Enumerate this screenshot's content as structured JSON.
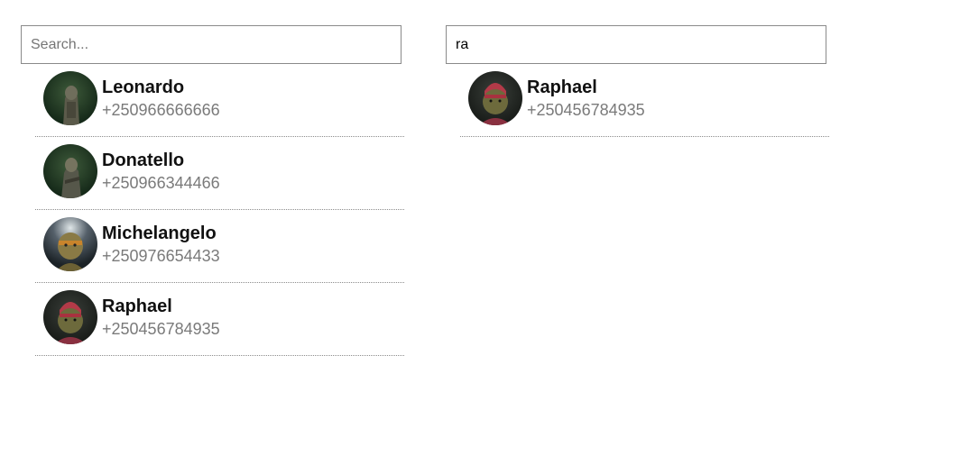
{
  "left_panel": {
    "search": {
      "placeholder": "Search...",
      "value": ""
    },
    "contacts": [
      {
        "name": "Leonardo",
        "phone": "+250966666666",
        "avatar": "turtle-avatar-icon"
      },
      {
        "name": "Donatello",
        "phone": "+250966344466",
        "avatar": "turtle-avatar-icon"
      },
      {
        "name": "Michelangelo",
        "phone": "+250976654433",
        "avatar": "turtle-avatar-icon"
      },
      {
        "name": "Raphael",
        "phone": "+250456784935",
        "avatar": "turtle-avatar-icon"
      }
    ]
  },
  "right_panel": {
    "search": {
      "placeholder": "Search...",
      "value": "ra"
    },
    "contacts": [
      {
        "name": "Raphael",
        "phone": "+250456784935",
        "avatar": "turtle-avatar-icon"
      }
    ]
  },
  "colors": {
    "name_text": "#111111",
    "phone_text": "#7a7a7a",
    "input_border": "#8a8a8a",
    "divider": "#8c8c8c"
  }
}
